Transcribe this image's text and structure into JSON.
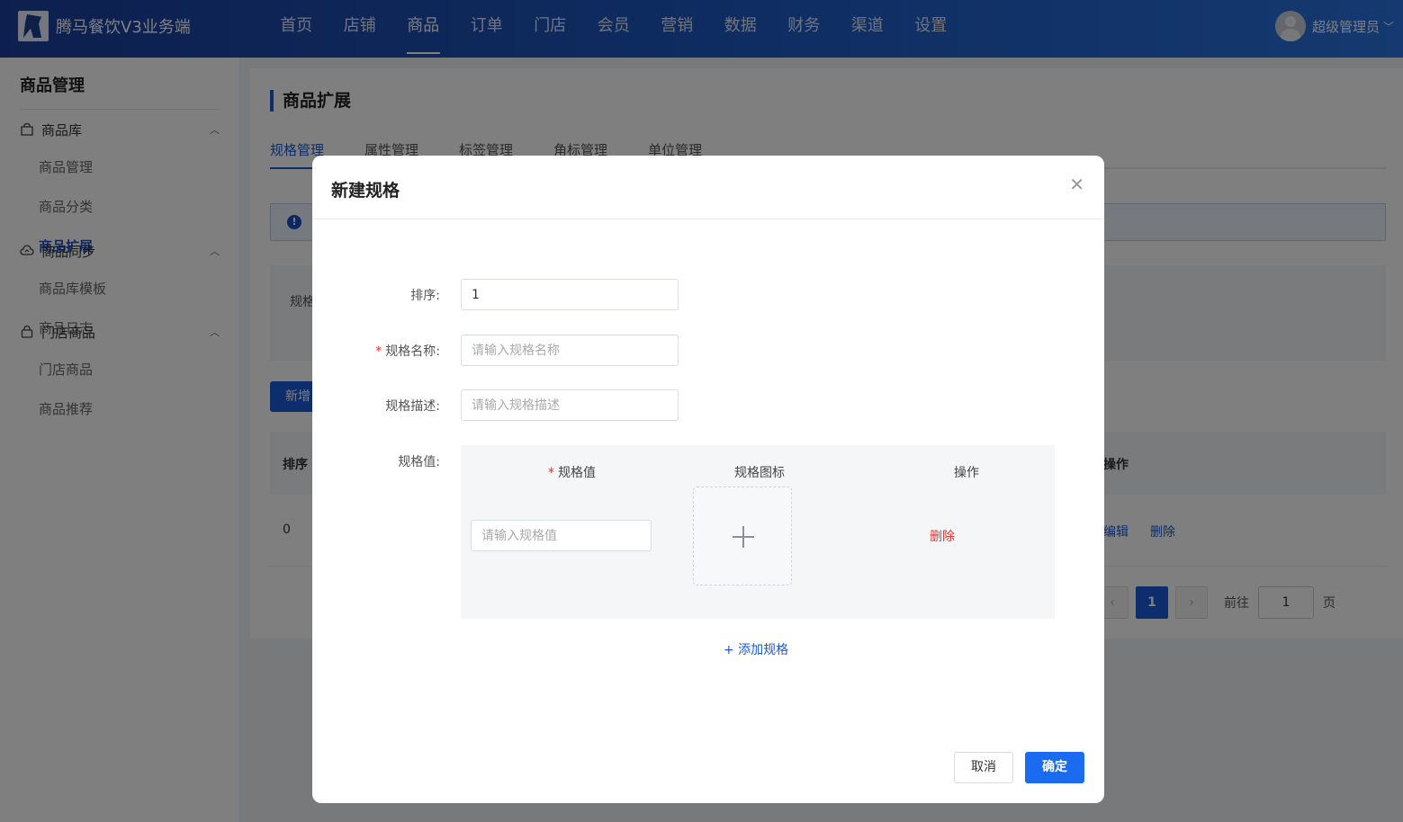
{
  "header": {
    "brand": "腾马餐饮V3业务端",
    "nav": [
      "首页",
      "店铺",
      "商品",
      "订单",
      "门店",
      "会员",
      "营销",
      "数据",
      "财务",
      "渠道",
      "设置"
    ],
    "active_nav": "商品",
    "user": "超级管理员"
  },
  "sidebar": {
    "title": "商品管理",
    "groups": [
      {
        "label": "商品库",
        "icon": "bag-icon",
        "items": [
          "商品管理",
          "商品分类",
          "商品扩展"
        ],
        "active": "商品扩展"
      },
      {
        "label": "商品同步",
        "icon": "cloud-sync-icon",
        "items": [
          "商品库模板",
          "商品日志"
        ]
      },
      {
        "label": "门店商品",
        "icon": "lock-bag-icon",
        "items": [
          "门店商品",
          "商品推荐"
        ]
      }
    ]
  },
  "main": {
    "title": "商品扩展",
    "tabs": [
      "规格管理",
      "属性管理",
      "标签管理",
      "角标管理",
      "单位管理"
    ],
    "active_tab": "规格管理",
    "filter_label": "规格",
    "new_button": "新增",
    "table": {
      "headers": [
        "排序",
        "操作"
      ],
      "rows": [
        {
          "sort": "0",
          "actions": [
            "编辑",
            "删除"
          ]
        }
      ]
    },
    "pagination": {
      "current": "1",
      "goto_label": "前往",
      "goto_value": "1",
      "page_suffix": "页"
    }
  },
  "modal": {
    "title": "新建规格",
    "fields": {
      "sort": {
        "label": "排序:",
        "value": "1"
      },
      "name": {
        "label": "规格名称:",
        "placeholder": "请输入规格名称",
        "required": true
      },
      "desc": {
        "label": "规格描述:",
        "placeholder": "请输入规格描述"
      },
      "values_label": "规格值:"
    },
    "spec_table": {
      "headers": {
        "value": "规格值",
        "icon": "规格图标",
        "action": "操作"
      },
      "row": {
        "placeholder": "请输入规格值",
        "delete": "删除"
      }
    },
    "add_spec": "+ 添加规格",
    "cancel": "取消",
    "confirm": "确定"
  },
  "colors": {
    "primary": "#1a5ad8",
    "danger": "#e5332b",
    "nav_bg": "#1e5bc6"
  }
}
